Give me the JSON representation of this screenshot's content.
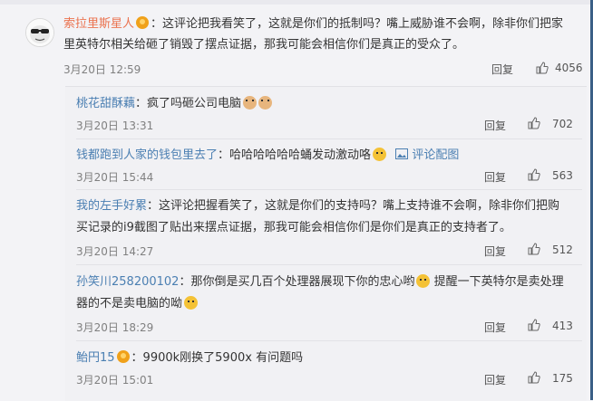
{
  "main": {
    "username": "索拉里斯星人",
    "text_line1": "：这评论把我看笑了，这就是你们的抵制吗？嘴上威胁谁不会啊，除非你们把家",
    "text_line2": "里英特尔相关给砸了销毁了摆点证据，那我可能会相信你们是真正的受众了。",
    "date": "3月20日 12:59",
    "reply_label": "回复",
    "likes": "4056"
  },
  "replies": [
    {
      "username": "桃花甜酥藕",
      "text": "：疯了吗砸公司电脑",
      "date": "3月20日 13:31",
      "reply_label": "回复",
      "likes": "702"
    },
    {
      "username": "钱都跑到人家的钱包里去了",
      "text": "：哈哈哈哈哈哈蛹发动激动咯",
      "pic_link": "评论配图",
      "date": "3月20日 15:44",
      "reply_label": "回复",
      "likes": "563"
    },
    {
      "username": "我的左手好累",
      "text_line1": "：这评论把握看笑了，这就是你们的支持吗？嘴上支持谁不会啊，除非你们把购",
      "text_line2": "买记录的i9截图了贴出来摆点证据，那我可能会相信你们是你们是真正的支持者了。",
      "date": "3月20日 14:27",
      "reply_label": "回复",
      "likes": "512"
    },
    {
      "username": "孙笑川258200102",
      "text_line1a": "：那你倒是买几百个处理器展现下你的忠心哟",
      "text_line1b": "提醒一下英特尔是卖处理",
      "text_line2": "器的不是卖电脑的呦",
      "date": "3月20日 18:29",
      "reply_label": "回复",
      "likes": "413"
    },
    {
      "username": "鲐円15",
      "text": "：9900k刚换了5900x 有问题吗",
      "date": "3月20日 15:01",
      "reply_label": "回复",
      "likes": "175"
    }
  ],
  "colors": {
    "username_main": "#eb7350",
    "username_reply": "#4b7fb2",
    "meta": "#808080",
    "background": "#f3f3f6"
  }
}
